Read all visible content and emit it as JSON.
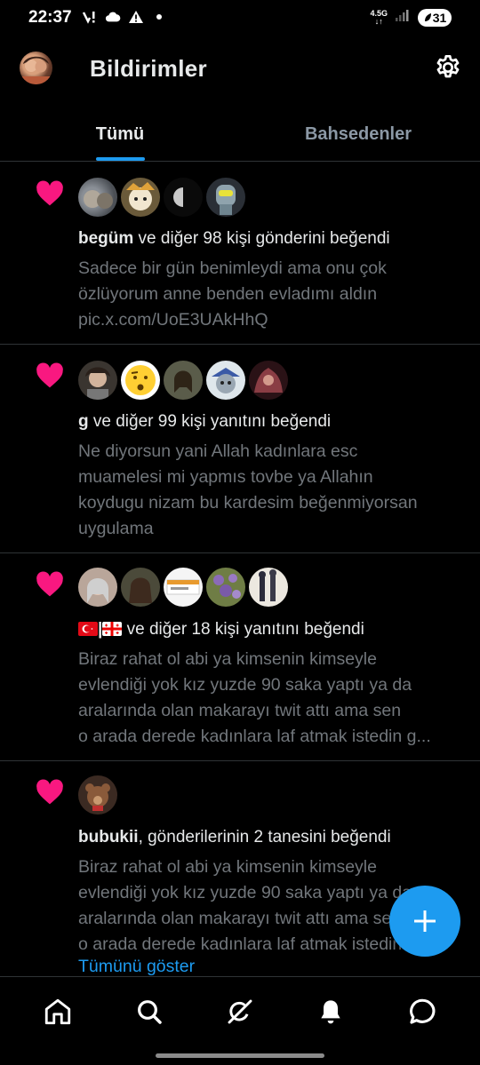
{
  "status_bar": {
    "time": "22:37",
    "network": "4.5G",
    "battery": "31"
  },
  "header": {
    "title": "Bildirimler"
  },
  "tabs": [
    {
      "label": "Tümü",
      "active": true
    },
    {
      "label": "Bahsedenler",
      "active": false
    }
  ],
  "notifications": [
    {
      "user": "begüm",
      "action": " ve diğer 98 kişi gönderini beğendi",
      "body": [
        "Sadece bir gün benimleydi ama onu çok",
        "özlüyorum anne benden evladımı aldın",
        "pic.x.com/UoE3UAkHhQ"
      ]
    },
    {
      "user": "g",
      "action": " ve diğer 99 kişi yanıtını beğendi",
      "body": [
        "Ne diyorsun yani Allah kadınlara esc",
        "muamelesi mi yapmıs tovbe ya Allahın",
        "koydugu nizam bu kardesim beğenmiyorsan",
        "uygulama"
      ]
    },
    {
      "user": "|",
      "action": " ve diğer 18 kişi yanıtını beğendi",
      "body": [
        "Biraz rahat ol abi ya kimsenin kimseyle",
        "evlendiği yok kız yuzde 90 saka yaptı ya da",
        "aralarında olan makarayı twit attı ama sen",
        "o arada derede kadınlara laf atmak istedin g..."
      ]
    },
    {
      "user": "bubukii",
      "action": ", gönderilerinin 2 tanesini beğendi",
      "body": [
        "Biraz rahat ol abi ya kimsenin kimseyle",
        "evlendiği yok kız yuzde 90 saka yaptı ya da",
        "aralarında olan makarayı twit attı ama sen",
        "o arada derede kadınlara laf atmak istedin g..."
      ],
      "show_more": "Tümünü göster"
    }
  ],
  "colors": {
    "accent": "#1d9bf0",
    "heart": "#f91880",
    "muted": "#71767b"
  },
  "bottom_nav": [
    "home-icon",
    "search-icon",
    "grok-icon",
    "notifications-icon",
    "messages-icon"
  ]
}
